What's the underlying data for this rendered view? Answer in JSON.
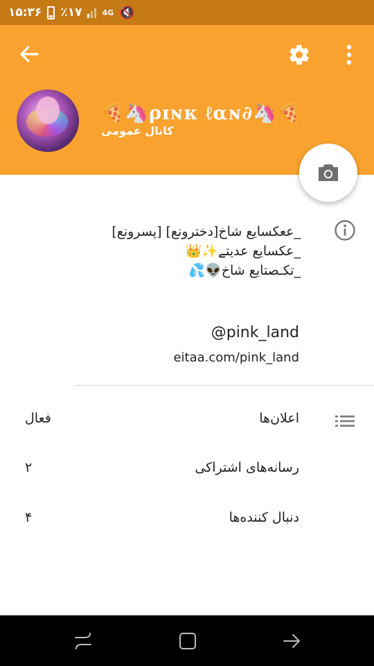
{
  "status": {
    "time": "۱۵:۳۶",
    "battery": "٪۱۷",
    "network": "4G"
  },
  "icons": {
    "back": "arrow-back-icon",
    "settings": "gear-icon",
    "more": "more-vertical-icon",
    "camera": "camera-icon",
    "info": "info-icon",
    "list": "list-icon"
  },
  "colors": {
    "status_bar": "#c57a16",
    "app_bar": "#f9a22f"
  },
  "channel": {
    "title": "🍕🦄ρɪɴк ℓαɴ∂🦄🍕",
    "type": "کانال عمومی"
  },
  "about": {
    "lines": [
      "_ععکسایع شاخ[دخترونع] [پسرونع]",
      "_عکسایع عدیتے✨👑",
      "_تکـصتایع شاخ👽💦"
    ]
  },
  "username": "@pink_land",
  "link": "eitaa.com/pink_land",
  "rows": [
    {
      "label": "اعلان‌ها",
      "value": "فعال"
    },
    {
      "label": "رسانه‌های اشتراکی",
      "value": "۲"
    },
    {
      "label": "دنبال کننده‌ها",
      "value": "۴"
    }
  ]
}
